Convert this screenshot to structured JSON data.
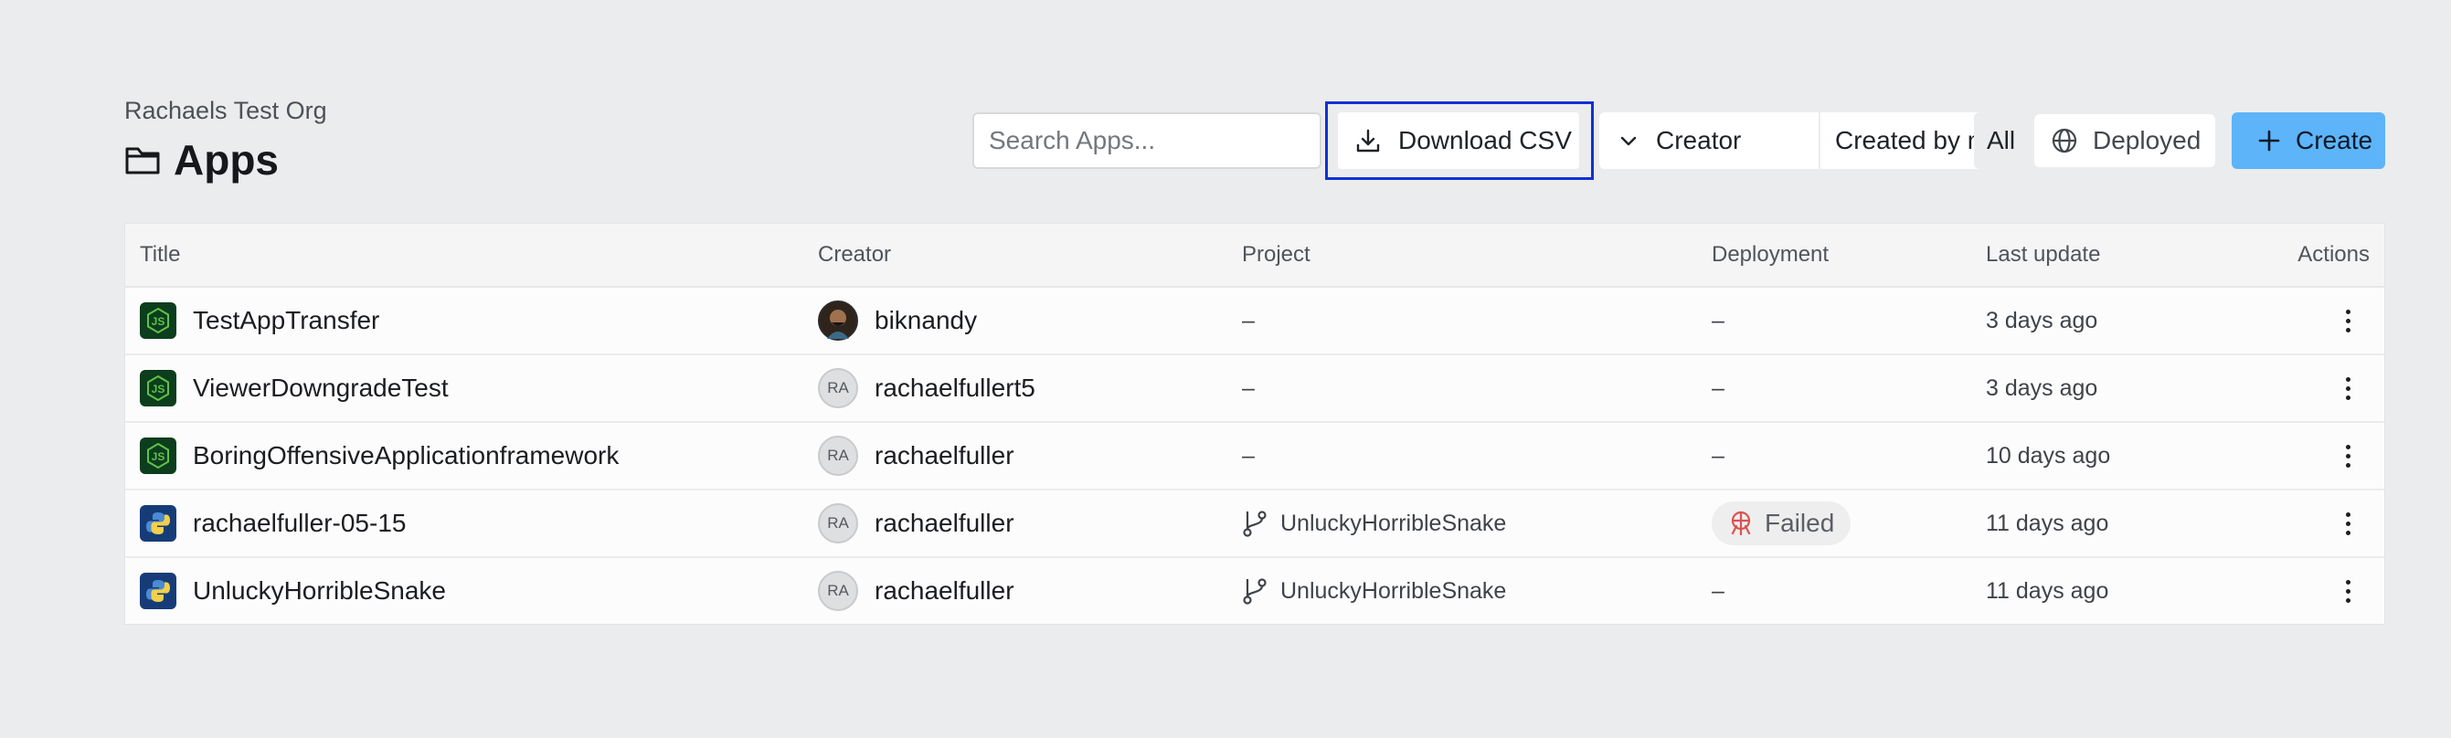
{
  "header": {
    "org": "Rachaels Test Org",
    "title": "Apps"
  },
  "toolbar": {
    "search_placeholder": "Search Apps...",
    "download_label": "Download CSV",
    "creator_label": "Creator",
    "created_by_me_label": "Created by me",
    "all_label": "All",
    "deployed_label": "Deployed",
    "create_label": "Create"
  },
  "colors": {
    "accent": "#5db4f9",
    "highlight": "#1230d6",
    "failed": "#d9534f"
  },
  "table": {
    "columns": [
      "Title",
      "Creator",
      "Project",
      "Deployment",
      "Last update",
      "Actions"
    ],
    "rows": [
      {
        "icon": "nodejs-icon",
        "title": "TestAppTransfer",
        "avatar": "",
        "creator": "biknandy",
        "project": "–",
        "deployment": "–",
        "updated": "3 days ago"
      },
      {
        "icon": "nodejs-icon",
        "title": "ViewerDowngradeTest",
        "avatar": "RA",
        "creator": "rachaelfullert5",
        "project": "–",
        "deployment": "–",
        "updated": "3 days ago"
      },
      {
        "icon": "nodejs-icon",
        "title": "BoringOffensiveApplicationframework",
        "avatar": "RA",
        "creator": "rachaelfuller",
        "project": "–",
        "deployment": "–",
        "updated": "10 days ago"
      },
      {
        "icon": "python-icon",
        "title": "rachaelfuller-05-15",
        "avatar": "RA",
        "creator": "rachaelfuller",
        "project": "UnluckyHorribleSnake",
        "deployment": "Failed",
        "updated": "11 days ago"
      },
      {
        "icon": "python-icon",
        "title": "UnluckyHorribleSnake",
        "avatar": "RA",
        "creator": "rachaelfuller",
        "project": "UnluckyHorribleSnake",
        "deployment": "–",
        "updated": "11 days ago"
      }
    ]
  }
}
